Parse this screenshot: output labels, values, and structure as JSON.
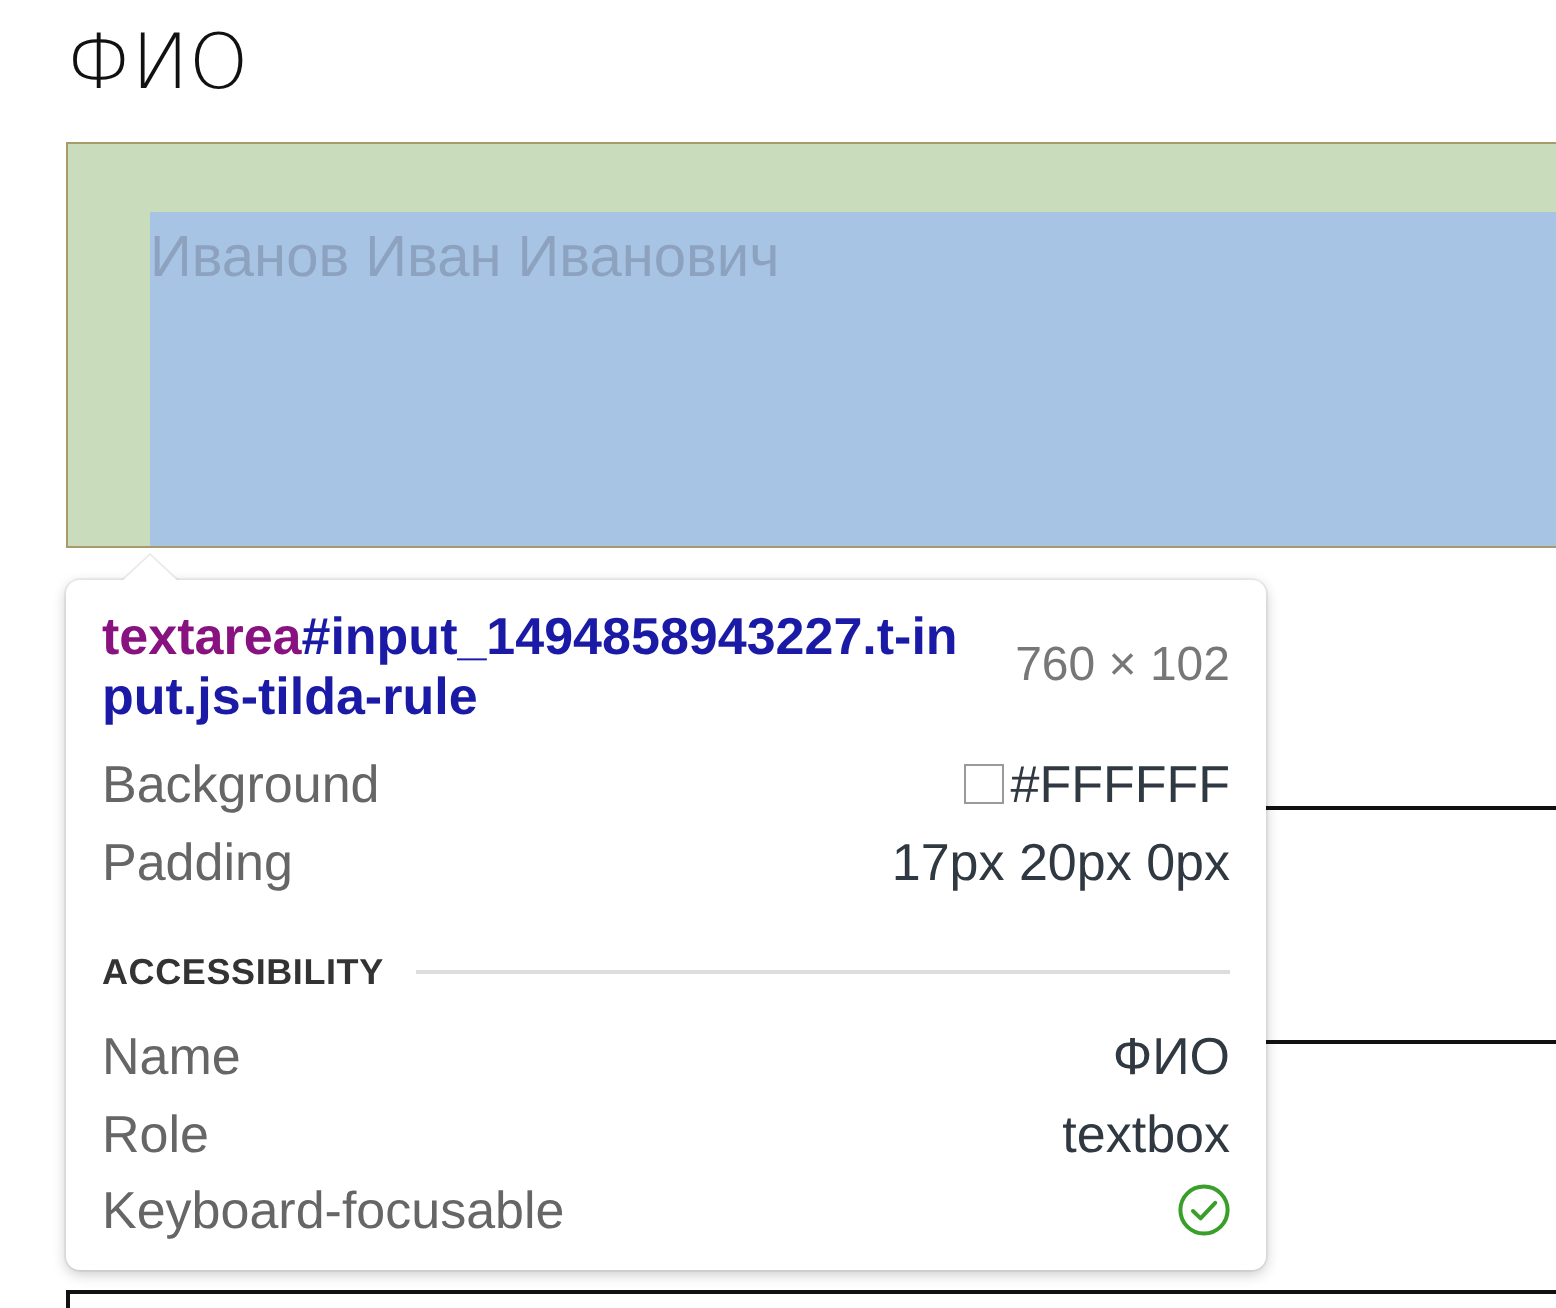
{
  "field": {
    "label": "ФИО",
    "placeholder": "Иванов Иван Иванович"
  },
  "inspector": {
    "tag": "textarea",
    "selector_lines": [
      "#input_1494858943227.t-in",
      "put.js-tilda-rule"
    ],
    "size": "760 × 102",
    "properties": [
      {
        "kind": "color",
        "label": "Background",
        "value": "#FFFFFF",
        "color": "#ffffff"
      },
      {
        "kind": "text",
        "label": "Padding",
        "value": "17px 20px 0px"
      }
    ],
    "accessibility": {
      "title": "ACCESSIBILITY",
      "rows": [
        {
          "kind": "text",
          "label": "Name",
          "value": "ФИО"
        },
        {
          "kind": "text",
          "label": "Role",
          "value": "textbox"
        },
        {
          "kind": "check",
          "label": "Keyboard-focusable",
          "checked": true
        }
      ]
    }
  }
}
